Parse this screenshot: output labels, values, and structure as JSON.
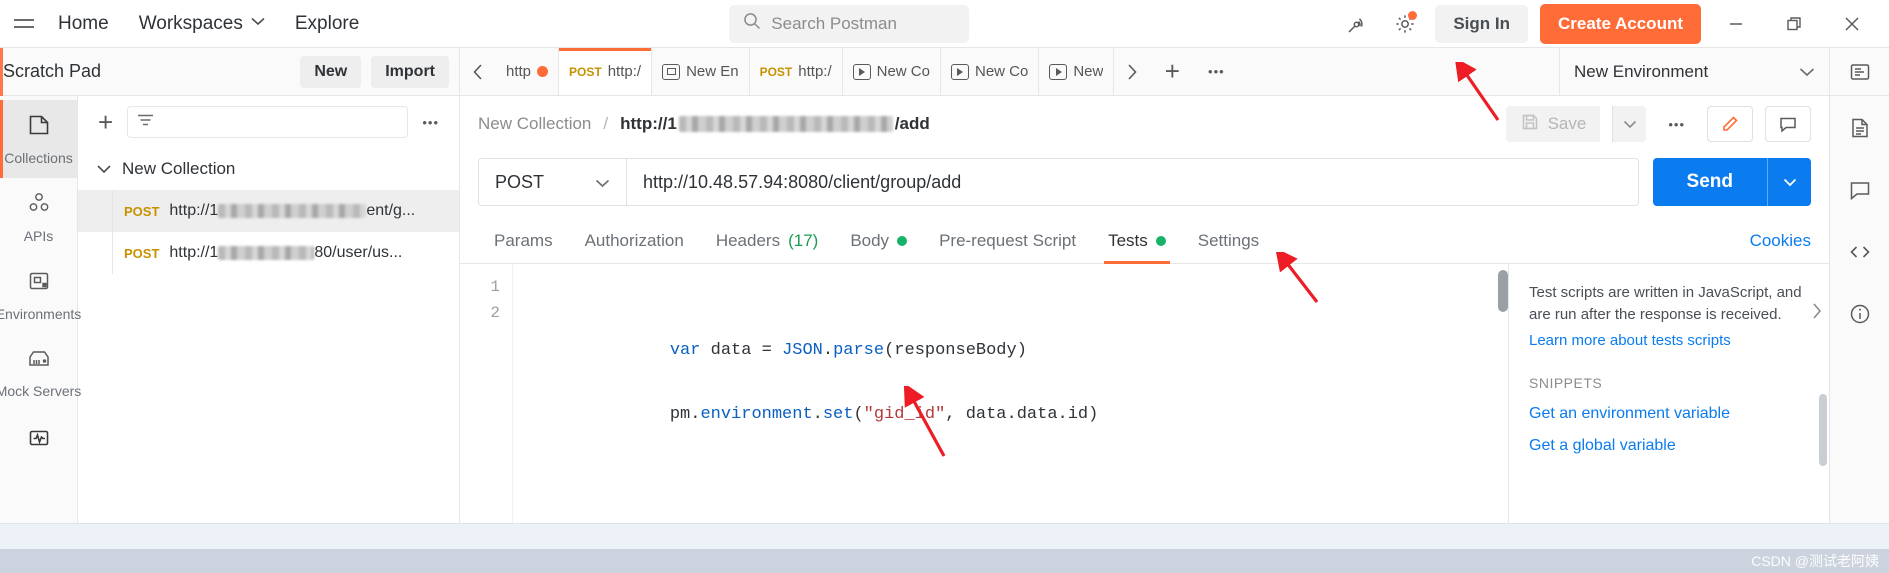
{
  "topbar": {
    "menu_icon": "hamburger-icon",
    "nav": [
      {
        "label": "Home"
      },
      {
        "label": "Workspaces"
      },
      {
        "label": "Explore"
      }
    ],
    "search": {
      "placeholder": "Search Postman",
      "icon": "search-icon",
      "value": ""
    },
    "satellite_icon": "satellite-icon",
    "gear_icon": "gear-icon",
    "sign_in_label": "Sign In",
    "create_account_label": "Create Account",
    "window_controls": {
      "minimize": "minimize-icon",
      "maximize": "restore-icon",
      "close": "close-icon"
    },
    "accent": "#ff6c37"
  },
  "workspace": {
    "title": "Scratch Pad",
    "new_label": "New",
    "import_label": "Import"
  },
  "tabbar": {
    "back_arrow": "chevron-left-icon",
    "forward_arrow": "chevron-right-icon",
    "add_label": "+",
    "more_label": "•••",
    "tabs": [
      {
        "method": "",
        "label": "http",
        "unsaved": true,
        "active": false,
        "icon": ""
      },
      {
        "method": "POST",
        "label": "http:/",
        "unsaved": false,
        "active": true,
        "icon": ""
      },
      {
        "method": "",
        "label": "New En",
        "unsaved": false,
        "active": false,
        "icon": "environment-icon"
      },
      {
        "method": "POST",
        "label": "http:/",
        "unsaved": false,
        "active": false,
        "icon": ""
      },
      {
        "method": "",
        "label": "New Co",
        "unsaved": false,
        "active": false,
        "icon": "runner-icon"
      },
      {
        "method": "",
        "label": "New Co",
        "unsaved": false,
        "active": false,
        "icon": "runner-icon"
      },
      {
        "method": "",
        "label": "New",
        "unsaved": false,
        "active": false,
        "icon": "runner-icon"
      }
    ]
  },
  "environment": {
    "selected": "New Environment",
    "chevron": "chevron-down-icon",
    "eye_icon": "environment-quick-look-icon"
  },
  "rail_left": [
    {
      "label": "Collections",
      "icon": "collections-icon",
      "active": true
    },
    {
      "label": "APIs",
      "icon": "apis-icon",
      "active": false
    },
    {
      "label": "Environments",
      "icon": "environments-icon",
      "active": false
    },
    {
      "label": "Mock Servers",
      "icon": "mock-servers-icon",
      "active": false
    },
    {
      "label": "Monitors",
      "icon": "monitors-icon",
      "active": false
    }
  ],
  "collections_panel": {
    "add_icon": "plus-icon",
    "filter_icon": "filter-icon",
    "filter_placeholder": "",
    "more_icon": "ellipsis-icon",
    "tree": [
      {
        "type": "folder",
        "name": "New Collection",
        "expanded": true,
        "chevron": "chevron-down-icon",
        "children": [
          {
            "type": "request",
            "method": "POST",
            "prefix": "http://1",
            "redacted": true,
            "suffix": "ent/g...",
            "selected": true
          },
          {
            "type": "request",
            "method": "POST",
            "prefix": "http://1",
            "redacted": true,
            "suffix": "80/user/us...",
            "selected": false
          }
        ]
      }
    ]
  },
  "request": {
    "breadcrumb": {
      "collection": "New Collection",
      "separator": "/",
      "name_prefix": "http://1",
      "name_suffix": "/add",
      "redacted": true
    },
    "save_label": "Save",
    "save_icon": "save-icon",
    "save_caret": "chevron-down-icon",
    "more_icon": "ellipsis-icon",
    "edit_icon": "pencil-icon",
    "comment_icon": "comment-icon",
    "method": "POST",
    "method_caret": "chevron-down-icon",
    "url": "http://10.48.57.94:8080/client/group/add",
    "send_label": "Send",
    "send_caret": "chevron-down-icon",
    "tabs": [
      {
        "label": "Params",
        "active": false,
        "badge": "",
        "dot": false
      },
      {
        "label": "Authorization",
        "active": false,
        "badge": "",
        "dot": false
      },
      {
        "label": "Headers",
        "active": false,
        "badge": "(17)",
        "dot": false
      },
      {
        "label": "Body",
        "active": false,
        "badge": "",
        "dot": true
      },
      {
        "label": "Pre-request Script",
        "active": false,
        "badge": "",
        "dot": false
      },
      {
        "label": "Tests",
        "active": true,
        "badge": "",
        "dot": true
      },
      {
        "label": "Settings",
        "active": false,
        "badge": "",
        "dot": false
      }
    ],
    "cookies_label": "Cookies"
  },
  "editor": {
    "lines": [
      {
        "num": "1",
        "tokens": [
          {
            "t": "var ",
            "c": "k-var"
          },
          {
            "t": "data ",
            "c": "k-plain"
          },
          {
            "t": "= ",
            "c": "k-plain"
          },
          {
            "t": "JSON",
            "c": "k-prop"
          },
          {
            "t": ".",
            "c": "k-plain"
          },
          {
            "t": "parse",
            "c": "k-fn"
          },
          {
            "t": "(responseBody)",
            "c": "k-plain"
          }
        ]
      },
      {
        "num": "2",
        "tokens": [
          {
            "t": "pm",
            "c": "k-plain"
          },
          {
            "t": ".",
            "c": "k-plain"
          },
          {
            "t": "environment",
            "c": "k-prop"
          },
          {
            "t": ".",
            "c": "k-plain"
          },
          {
            "t": "set",
            "c": "k-fn"
          },
          {
            "t": "(",
            "c": "k-plain"
          },
          {
            "t": "\"gid_id\"",
            "c": "k-str"
          },
          {
            "t": ", data.data.id)",
            "c": "k-plain"
          }
        ]
      }
    ]
  },
  "snippets": {
    "description": "Test scripts are written in JavaScript, and are run after the response is received.",
    "learn_more": "Learn more about tests scripts",
    "section_title": "SNIPPETS",
    "items": [
      {
        "label": "Get an environment variable"
      },
      {
        "label": "Get a global variable"
      }
    ],
    "collapse_icon": "chevron-right-icon"
  },
  "rail_right": [
    {
      "icon": "docs-icon"
    },
    {
      "icon": "comments-icon"
    },
    {
      "icon": "code-icon"
    },
    {
      "icon": "info-icon"
    }
  ],
  "footer": {
    "watermark": "CSDN @测试老阿姨"
  },
  "annotations": [
    {
      "name": "arrow-to-new-environment"
    },
    {
      "name": "arrow-to-tests-tab"
    },
    {
      "name": "arrow-to-gid-id-string"
    }
  ]
}
